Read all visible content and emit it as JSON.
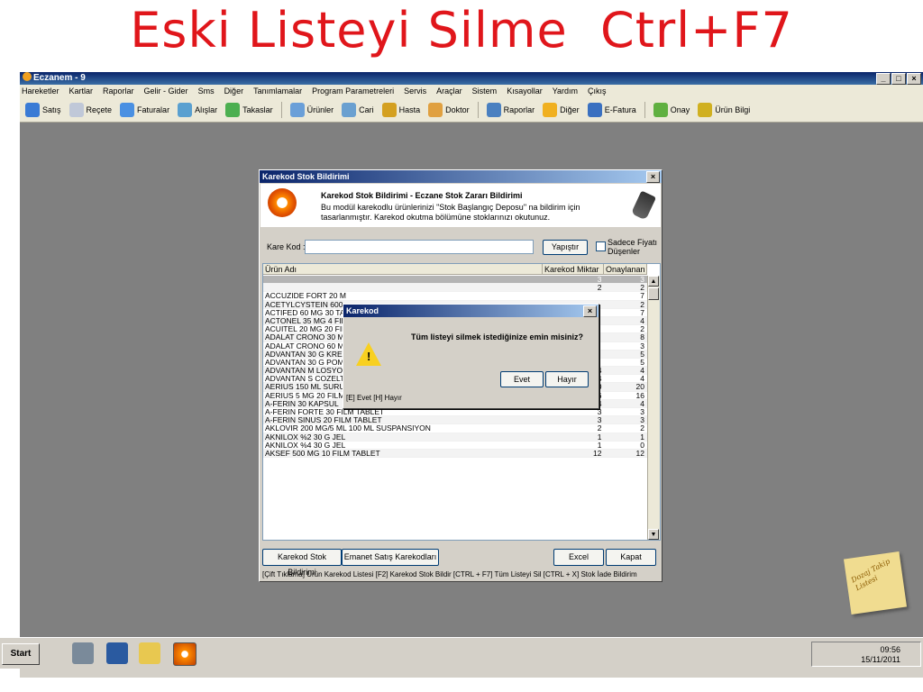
{
  "slide_title": "Eski Listeyi Silme  Ctrl+F7",
  "app": {
    "title": "Eczanem - 9",
    "menu": [
      "Hareketler",
      "Kartlar",
      "Raporlar",
      "Gelir - Gider",
      "Sms",
      "Diğer",
      "Tanımlamalar",
      "Program Parametreleri",
      "Servis",
      "Araçlar",
      "Sistem",
      "Kısayollar",
      "Yardım",
      "Çıkış"
    ],
    "toolbar": [
      {
        "label": "Satış",
        "icon": "cart-icon",
        "color": "#3a7bd5"
      },
      {
        "label": "Reçete",
        "icon": "document-icon",
        "color": "#c0c8d8"
      },
      {
        "label": "Faturalar",
        "icon": "invoice-icon",
        "color": "#4a90e2"
      },
      {
        "label": "Alışlar",
        "icon": "purchase-icon",
        "color": "#5aa0d0"
      },
      {
        "label": "Takaslar",
        "icon": "swap-icon",
        "color": "#4caf50"
      },
      {
        "label": "Ürünler",
        "icon": "products-icon",
        "color": "#6a9fd8"
      },
      {
        "label": "Cari",
        "icon": "accounts-icon",
        "color": "#6aa0d0"
      },
      {
        "label": "Hasta",
        "icon": "patient-icon",
        "color": "#d4a020"
      },
      {
        "label": "Doktor",
        "icon": "doctor-icon",
        "color": "#e0a040"
      },
      {
        "label": "Raporlar",
        "icon": "reports-icon",
        "color": "#4a80c0"
      },
      {
        "label": "Diğer",
        "icon": "other-icon",
        "color": "#f0b020"
      },
      {
        "label": "E-Fatura",
        "icon": "efatura-icon",
        "color": "#3a70c0"
      },
      {
        "label": "Onay",
        "icon": "approve-icon",
        "color": "#60b040"
      },
      {
        "label": "Ürün Bilgi",
        "icon": "product-info-icon",
        "color": "#d0b020"
      }
    ]
  },
  "stock_window": {
    "title": "Karekod Stok Bildirimi",
    "header_title": "Karekod Stok Bildirimi - Eczane Stok Zararı Bildirimi",
    "header_desc": "Bu modül karekodlu ürünlerinizi \"Stok Başlangıç Deposu\" na bildirim için tasarlanmıştır. Karekod okutma bölümüne stoklarınızı okutunuz.",
    "kare_kod_label": "Kare Kod :",
    "kare_kod_value": "",
    "paste_button": "Yapıştır",
    "checkbox_label_1": "Sadece Fiyatı",
    "checkbox_label_2": "Düşenler",
    "columns": [
      "Ürün Adı",
      "Karekod Miktar",
      "Onaylanan"
    ],
    "rows": [
      {
        "name": "",
        "qty": "3",
        "approved": "3"
      },
      {
        "name": "",
        "qty": "2",
        "approved": "2"
      },
      {
        "name": "ACCUZIDE FORT 20 M",
        "qty": "",
        "approved": "7"
      },
      {
        "name": "ACETYLCYSTEIN 600",
        "qty": "",
        "approved": "2"
      },
      {
        "name": "ACTIFED 60 MG 30 TA",
        "qty": "",
        "approved": "7"
      },
      {
        "name": "ACTONEL 35 MG 4 FIL",
        "qty": "",
        "approved": "4"
      },
      {
        "name": "ACUITEL 20 MG 20 FIL",
        "qty": "",
        "approved": "2"
      },
      {
        "name": "ADALAT CRONO 30 M",
        "qty": "",
        "approved": "8"
      },
      {
        "name": "ADALAT CRONO 60 M",
        "qty": "",
        "approved": "3"
      },
      {
        "name": "ADVANTAN 30 G KREI",
        "qty": "",
        "approved": "5"
      },
      {
        "name": "ADVANTAN 30 G POM",
        "qty": "",
        "approved": "5"
      },
      {
        "name": "ADVANTAN M LOSYON 50 G",
        "qty": "4",
        "approved": "4"
      },
      {
        "name": "ADVANTAN S COZELTI %0.1 20 ML",
        "qty": "4",
        "approved": "4"
      },
      {
        "name": "AERIUS 150 ML SURUP",
        "qty": "20",
        "approved": "20"
      },
      {
        "name": "AERIUS 5 MG 20 FILM TABLET",
        "qty": "16",
        "approved": "16"
      },
      {
        "name": "A-FERIN 30 KAPSUL",
        "qty": "4",
        "approved": "4"
      },
      {
        "name": "A-FERIN FORTE 30 FILM TABLET",
        "qty": "3",
        "approved": "3"
      },
      {
        "name": "A-FERIN SINUS 20 FILM TABLET",
        "qty": "3",
        "approved": "3"
      },
      {
        "name": "AKLOVIR 200 MG/5 ML 100 ML SUSPANSIYON",
        "qty": "2",
        "approved": "2"
      },
      {
        "name": "AKNILOX %2  30 G JEL",
        "qty": "1",
        "approved": "1"
      },
      {
        "name": "AKNILOX %4 30 G JEL",
        "qty": "1",
        "approved": "0"
      },
      {
        "name": "AKSEF 500 MG 10 FILM TABLET",
        "qty": "12",
        "approved": "12"
      }
    ],
    "btn_stock_notice": "Karekod Stok Bildirimi",
    "btn_consignment": "Emanet Satış Karekodları",
    "btn_excel": "Excel",
    "btn_close": "Kapat",
    "shortcut_hint": "[Çift Tıklama] Ürün Karekod Listesi  [F2] Karekod Stok Bildir  [CTRL + F7] Tüm Listeyi Sil  [CTRL + X] Stok İade Bildirim"
  },
  "dialog": {
    "title": "Karekod",
    "message": "Tüm listeyi silmek istediğinize emin misiniz?",
    "yes": "Evet",
    "no": "Hayır",
    "hint": "[E] Evet   [H] Hayır"
  },
  "note": {
    "line1": "Dozaj Takip",
    "line2": "Listesi"
  },
  "taskbar": {
    "start": "Start",
    "time": "09:56",
    "date": "15/11/2011"
  }
}
